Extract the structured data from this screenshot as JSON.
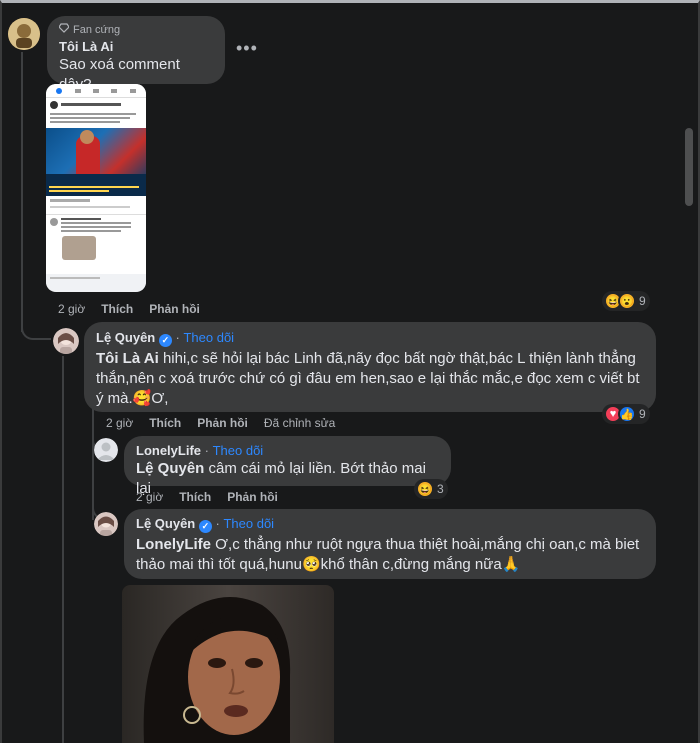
{
  "comments": [
    {
      "badge": "Fan cứng",
      "author": "Tôi Là Ai",
      "text": "Sao xoá comment dậy?",
      "time": "2 giờ",
      "like": "Thích",
      "reply": "Phản hồi",
      "reaction_count": "9",
      "more_label": "•••"
    },
    {
      "author": "Lệ Quyên",
      "follow": "Theo dõi",
      "mention": "Tôi Là Ai",
      "text": " hihi,c sẽ hỏi lại bác Linh đã,nãy đọc bất ngờ thật,bác L thiện lành thẳng thắn,nên c xoá trước chứ có gì đâu em hen,sao e lại thắc mắc,e đọc xem c viết bt ý mà.🥰Ơ,",
      "time": "2 giờ",
      "like": "Thích",
      "reply": "Phản hồi",
      "edited": "Đã chỉnh sửa",
      "reaction_count": "9"
    },
    {
      "author": "LonelyLife",
      "follow": "Theo dõi",
      "mention": "Lệ Quyên",
      "text": " câm cái mỏ lại liền. Bớt thảo mai lại",
      "time": "2 giờ",
      "like": "Thích",
      "reply": "Phản hồi",
      "reaction_count": "3"
    },
    {
      "author": "Lệ Quyên",
      "follow": "Theo dõi",
      "mention": "LonelyLife",
      "text": " Ơ,c thẳng như ruột ngựa thua thiệt hoài,mắng chị oan,c mà biet thảo mai thì tốt quá,hunu🥺khổ thân c,đừng mắng nữa🙏"
    }
  ],
  "colors": {
    "background": "#18191a",
    "bubble": "#3a3b3c",
    "link": "#2d88ff"
  }
}
